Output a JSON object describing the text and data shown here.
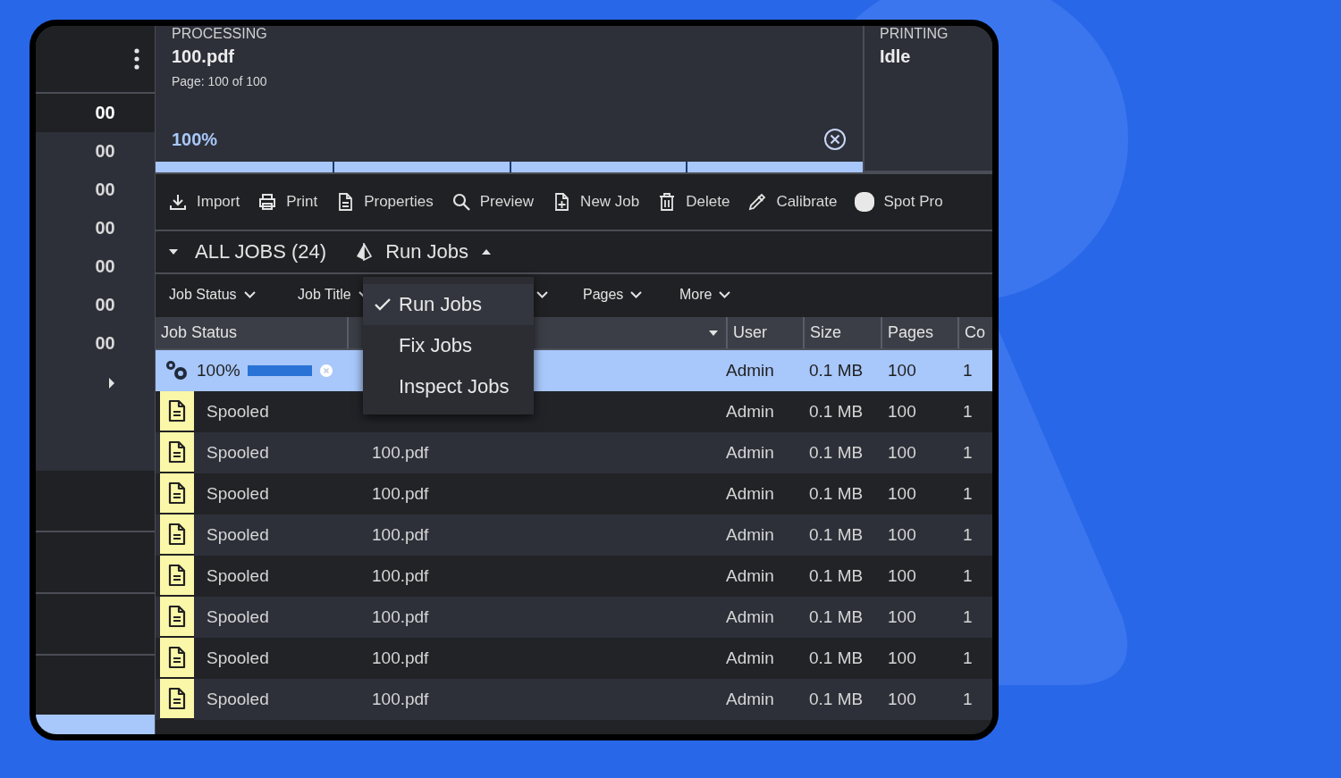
{
  "sidebar": {
    "items": [
      {
        "label": "00",
        "selected": true
      },
      {
        "label": "00",
        "selected": false
      },
      {
        "label": "00",
        "selected": false
      },
      {
        "label": "00",
        "selected": false
      },
      {
        "label": "00",
        "selected": false
      },
      {
        "label": "00",
        "selected": false
      },
      {
        "label": "00",
        "selected": false
      }
    ]
  },
  "processing": {
    "heading": "PROCESSING",
    "file": "100.pdf",
    "page": "Page: 100 of 100",
    "percent": "100%",
    "level": 1
  },
  "printing": {
    "heading": "PRINTING",
    "status": "Idle"
  },
  "toolbar": [
    "Import",
    "Print",
    "Properties",
    "Preview",
    "New Job",
    "Delete",
    "Calibrate",
    "Spot Pro"
  ],
  "jobs_header": {
    "title": "ALL JOBS (24)",
    "view": "Run Jobs",
    "expanded": true
  },
  "filters": [
    {
      "kind": "labeled",
      "label": "Job Status"
    },
    {
      "kind": "labeled",
      "label": "Job Title"
    },
    {
      "kind": "covered"
    },
    {
      "kind": "labeled",
      "label": "Pages"
    },
    {
      "kind": "labeled",
      "label": "More"
    }
  ],
  "view_menu": [
    {
      "label": "Run Jobs",
      "selected": true
    },
    {
      "label": "Fix Jobs",
      "selected": false
    },
    {
      "label": "Inspect Jobs",
      "selected": false
    }
  ],
  "table": {
    "columns": [
      "Job Status",
      "User",
      "Size",
      "Pages",
      "Co"
    ],
    "rows": [
      {
        "kind": "processing",
        "selected": true,
        "progress": "100%",
        "level": 1,
        "user": "Admin",
        "size": "0.1 MB",
        "pages": "100",
        "copies": "1"
      },
      {
        "kind": "spooled",
        "selected": false,
        "status": "Spooled",
        "user": "Admin",
        "size": "0.1 MB",
        "pages": "100",
        "copies": "1"
      },
      {
        "kind": "spooled",
        "selected": false,
        "status": "Spooled",
        "title": "100.pdf",
        "user": "Admin",
        "size": "0.1 MB",
        "pages": "100",
        "copies": "1"
      },
      {
        "kind": "spooled",
        "selected": false,
        "status": "Spooled",
        "title": "100.pdf",
        "user": "Admin",
        "size": "0.1 MB",
        "pages": "100",
        "copies": "1"
      },
      {
        "kind": "spooled",
        "selected": false,
        "status": "Spooled",
        "title": "100.pdf",
        "user": "Admin",
        "size": "0.1 MB",
        "pages": "100",
        "copies": "1"
      },
      {
        "kind": "spooled",
        "selected": false,
        "status": "Spooled",
        "title": "100.pdf",
        "user": "Admin",
        "size": "0.1 MB",
        "pages": "100",
        "copies": "1"
      },
      {
        "kind": "spooled",
        "selected": false,
        "status": "Spooled",
        "title": "100.pdf",
        "user": "Admin",
        "size": "0.1 MB",
        "pages": "100",
        "copies": "1"
      },
      {
        "kind": "spooled",
        "selected": false,
        "status": "Spooled",
        "title": "100.pdf",
        "user": "Admin",
        "size": "0.1 MB",
        "pages": "100",
        "copies": "1"
      },
      {
        "kind": "spooled",
        "selected": false,
        "status": "Spooled",
        "title": "100.pdf",
        "user": "Admin",
        "size": "0.1 MB",
        "pages": "100",
        "copies": "1"
      }
    ]
  }
}
